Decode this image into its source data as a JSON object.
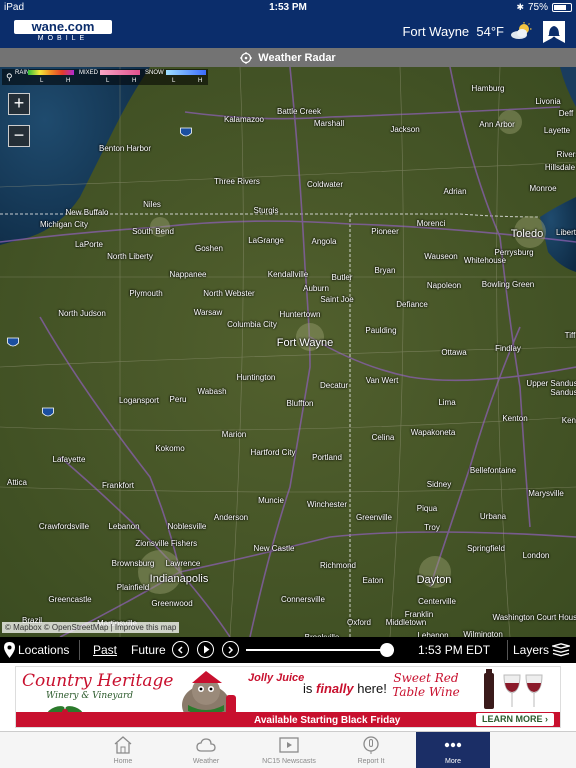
{
  "status_bar": {
    "device": "iPad",
    "time": "1:53 PM",
    "battery": "75%",
    "battery_level": 0.75
  },
  "header": {
    "logo_text": "wane.com",
    "logo_sub": "MOBILE",
    "location": "Fort Wayne",
    "temperature": "54°F",
    "weather_icon": "partly-cloudy-icon",
    "alert_icon": "bell-alert-icon"
  },
  "titlebar": {
    "title": "Weather Radar",
    "icon": "crosshair-icon"
  },
  "map": {
    "legend": {
      "rain": "RAIN",
      "mixed": "MIXED",
      "snow": "SNOW",
      "low": "L",
      "high": "H"
    },
    "zoom_in": "+",
    "zoom_out": "−",
    "attribution": "© Mapbox © OpenStreetMap | Improve this map",
    "cities": [
      "Hamburg",
      "Livonia",
      "Battle Creek",
      "Kalamazoo",
      "Marshall",
      "Jackson",
      "Ann Arbor",
      "Layette",
      "Benton Harbor",
      "Three Rivers",
      "Coldwater",
      "Adrian",
      "Monroe",
      "Niles",
      "Sturgis",
      "New Buffalo",
      "Michigan City",
      "South Bend",
      "LaGrange",
      "Angola",
      "Pioneer",
      "Morenci",
      "Toledo",
      "LaPorte",
      "Goshen",
      "Bryan",
      "Wauseon",
      "Perrysburg",
      "Whitehouse",
      "North Liberty",
      "Nappanee",
      "Kendallville",
      "Butler",
      "Napoleon",
      "Bowling Green",
      "Plymouth",
      "North Webster",
      "Auburn",
      "Saint Joe",
      "Defiance",
      "North Judson",
      "Warsaw",
      "Huntertown",
      "Columbia City",
      "Paulding",
      "Fort Wayne",
      "Ottawa",
      "Findlay",
      "Huntington",
      "Decatur",
      "Van Wert",
      "Upper Sandusky",
      "Logansport",
      "Peru",
      "Wabash",
      "Bluffton",
      "Lima",
      "Kenton",
      "Marion",
      "Celina",
      "Wapakoneta",
      "Kokomo",
      "Hartford City",
      "Portland",
      "Lafayette",
      "Bellefontaine",
      "Frankfort",
      "Sidney",
      "Marysville",
      "Attica",
      "Muncie",
      "Winchester",
      "Anderson",
      "Greenville",
      "Piqua",
      "Urbana",
      "Troy",
      "Crawfordsville",
      "Lebanon",
      "Noblesville",
      "Zionsville",
      "Fishers",
      "New Castle",
      "Springfield",
      "London",
      "Brownsburg",
      "Lawrence",
      "Richmond",
      "Dayton",
      "Plainfield",
      "Indianapolis",
      "Eaton",
      "Greencastle",
      "Greenwood",
      "Connersville",
      "Centerville",
      "Washington Court House",
      "Brazil",
      "Martinsville",
      "Oxford",
      "Franklin",
      "Middletown",
      "Brookville",
      "Lebanon",
      "Wilmington",
      "Tiff",
      "Kent",
      "Deff",
      "Rivers",
      "Hillsdale",
      "Liberty",
      "Sandusky"
    ]
  },
  "player": {
    "locations": "Locations",
    "past": "Past",
    "future": "Future",
    "time": "1:53 PM EDT",
    "layers": "Layers",
    "progress": 0.95
  },
  "ad": {
    "brand": "Country Heritage",
    "brand_sub": "Winery & Vineyard",
    "product": "Jolly Juice",
    "is_text": "is",
    "finally": "finally",
    "here": "here!",
    "sweet_red": "Sweet Red",
    "table_wine": "Table Wine",
    "available": "Available Starting Black Friday",
    "learn_more": "LEARN MORE ›"
  },
  "tabs": [
    {
      "label": "Home",
      "icon": "home-icon"
    },
    {
      "label": "Weather",
      "icon": "cloud-icon"
    },
    {
      "label": "NC15 Newscasts",
      "icon": "play-icon"
    },
    {
      "label": "Report It",
      "icon": "report-icon"
    },
    {
      "label": "More",
      "icon": "more-dots-icon"
    }
  ],
  "colors": {
    "header": "#0b2d6b",
    "tab_active": "#1b2e66",
    "ad_red": "#c8102e"
  }
}
